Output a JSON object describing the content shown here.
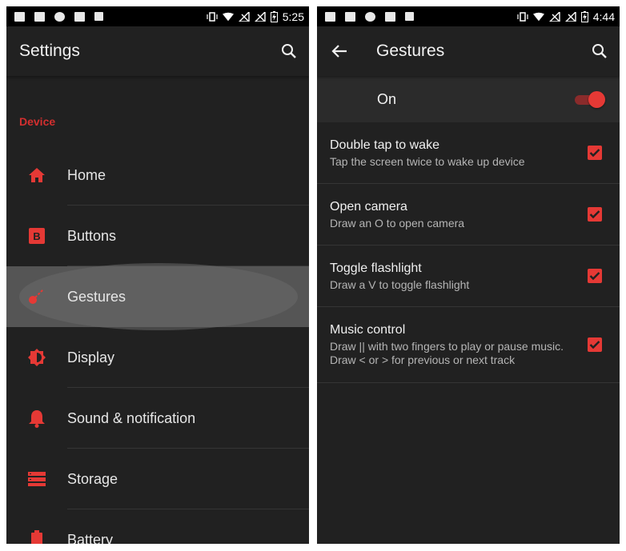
{
  "left": {
    "status": {
      "time": "5:25"
    },
    "toolbar": {
      "title": "Settings",
      "search_icon": "search-icon"
    },
    "section": "Device",
    "items": [
      {
        "label": "Home",
        "icon": "home-icon"
      },
      {
        "label": "Buttons",
        "icon": "buttons-icon"
      },
      {
        "label": "Gestures",
        "icon": "gestures-icon"
      },
      {
        "label": "Display",
        "icon": "display-icon"
      },
      {
        "label": "Sound & notification",
        "icon": "bell-icon"
      },
      {
        "label": "Storage",
        "icon": "storage-icon"
      },
      {
        "label": "Battery",
        "icon": "battery-icon"
      }
    ]
  },
  "right": {
    "status": {
      "time": "4:44"
    },
    "toolbar": {
      "title": "Gestures",
      "back_icon": "back-arrow-icon",
      "search_icon": "search-icon"
    },
    "master": {
      "label": "On",
      "enabled": true
    },
    "gestures": [
      {
        "title": "Double tap to wake",
        "subtitle": "Tap the screen twice to wake up device",
        "checked": true
      },
      {
        "title": "Open camera",
        "subtitle": "Draw an O to open camera",
        "checked": true
      },
      {
        "title": "Toggle flashlight",
        "subtitle": "Draw a V to toggle flashlight",
        "checked": true
      },
      {
        "title": "Music control",
        "subtitle": "Draw || with two fingers to play or pause music. Draw < or > for previous or next track",
        "checked": true
      }
    ]
  },
  "colors": {
    "accent": "#e53935",
    "section": "#d32f2f",
    "background": "#212121",
    "statusbar": "#000000"
  }
}
